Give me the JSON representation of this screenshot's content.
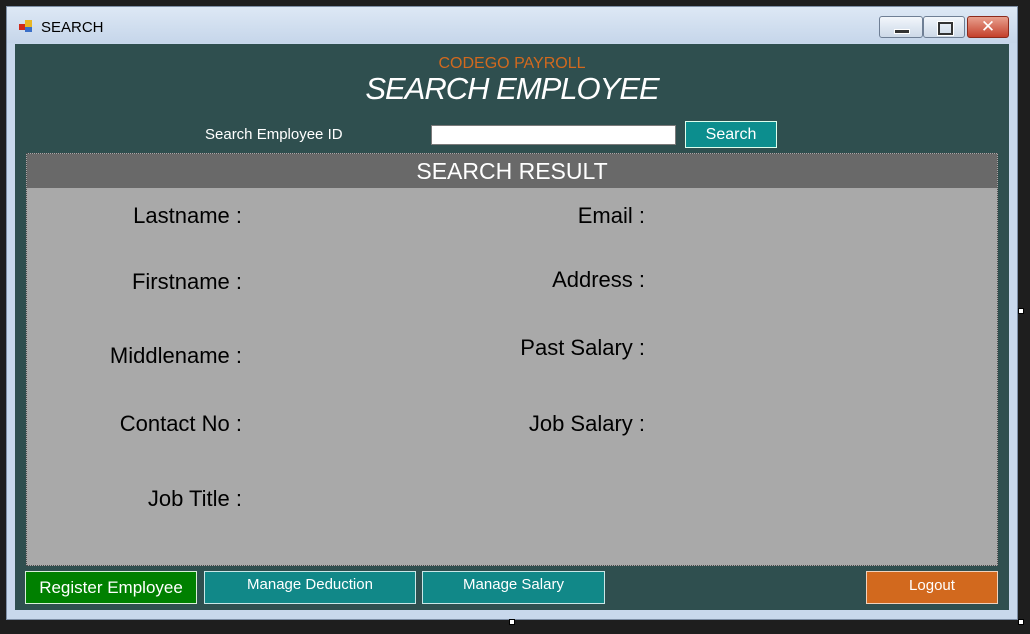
{
  "window": {
    "title": "SEARCH"
  },
  "header": {
    "brand": "CODEGO PAYROLL",
    "title": "SEARCH EMPLOYEE"
  },
  "search": {
    "label": "Search Employee ID",
    "value": "",
    "button_label": "Search"
  },
  "result": {
    "header": "SEARCH RESULT",
    "left_labels": [
      "Lastname :",
      "Firstname :",
      "Middlename :",
      "Contact No :",
      "Job Title :"
    ],
    "right_labels": [
      "Email :",
      "Address :",
      "Past Salary :",
      "Job Salary :"
    ]
  },
  "actions": {
    "register": "Register Employee",
    "deduction": "Manage Deduction",
    "salary": "Manage Salary",
    "logout": "Logout"
  },
  "colors": {
    "client_background": "#2f4f4f",
    "panel_background": "#a9a9a9",
    "panel_header": "#696969",
    "brand_text": "#d2691e",
    "teal_button": "#118888",
    "register_button": "#008000",
    "logout_button": "#d2691e"
  }
}
